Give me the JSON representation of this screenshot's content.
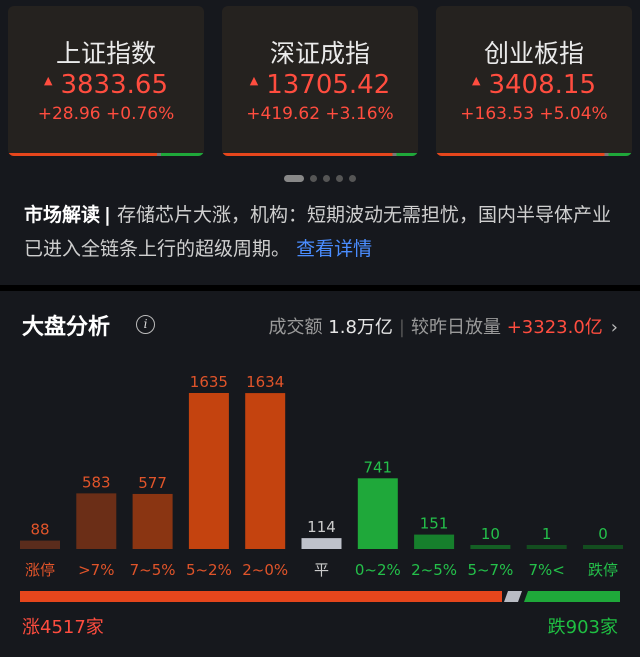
{
  "indices": [
    {
      "name": "上证指数",
      "price": "3833.65",
      "change": "+28.96 +0.76%"
    },
    {
      "name": "深证成指",
      "price": "13705.42",
      "change": "+419.62 +3.16%"
    },
    {
      "name": "创业板指",
      "price": "3408.15",
      "change": "+163.53 +5.04%"
    }
  ],
  "up_arrow": "▲",
  "carousel": {
    "pages": 5,
    "active": 0
  },
  "news": {
    "label": "市场解读",
    "separator": "|",
    "text": "存储芯片大涨，机构：短期波动无需担忧，国内半导体产业已进入全链条上行的超级周期。",
    "link": "查看详情"
  },
  "analysis": {
    "title": "大盘分析",
    "info_icon": "i",
    "turnover_label": "成交额",
    "turnover_value": "1.8万亿",
    "compare_label": "较昨日放量",
    "compare_value": "+3323.0亿",
    "chevron": "›"
  },
  "chart_data": {
    "type": "bar",
    "categories": [
      "涨停",
      ">7%",
      "7~5%",
      "5~2%",
      "2~0%",
      "平",
      "0~2%",
      "2~5%",
      "5~7%",
      "7%<",
      "跌停"
    ],
    "values": [
      88,
      583,
      577,
      1635,
      1634,
      114,
      741,
      151,
      10,
      1,
      0
    ],
    "colors": [
      "#5a2c1c",
      "#6b2e17",
      "#8a3512",
      "#c4430f",
      "#c4430f",
      "#bfc2cb",
      "#1fa83a",
      "#167f2c",
      "#145f24",
      "#134d1f",
      "#134d1f"
    ],
    "label_colors": [
      "#e0542a",
      "#e0542a",
      "#e0542a",
      "#e0542a",
      "#e0542a",
      "#cccccc",
      "#24c04a",
      "#24c04a",
      "#24c04a",
      "#24c04a",
      "#24c04a"
    ]
  },
  "breadth": {
    "up_label": "涨4517家",
    "down_label": "跌903家",
    "up": 4517,
    "flat": 114,
    "down": 903
  },
  "colors": {
    "up": "#ff4d3f",
    "down": "#1fbf42",
    "link": "#4a8dff"
  }
}
